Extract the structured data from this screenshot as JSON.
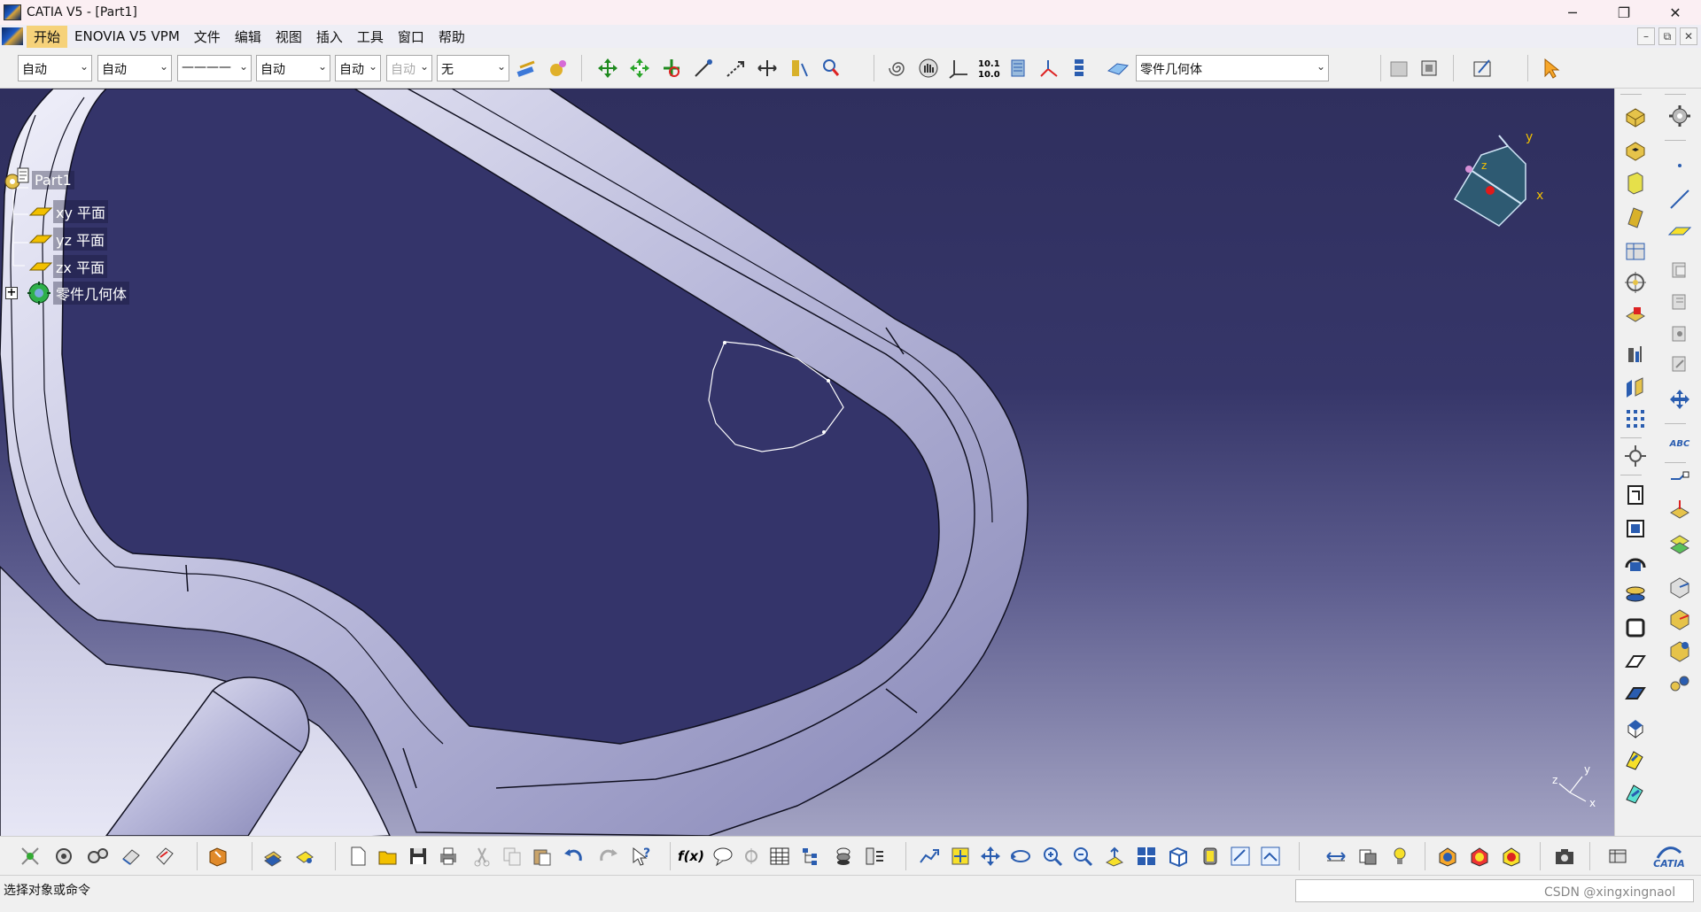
{
  "window": {
    "title": "CATIA V5 - [Part1]",
    "controls": {
      "minimize": "─",
      "restore": "❐",
      "close": "✕"
    }
  },
  "menubar": {
    "items": [
      "开始",
      "ENOVIA V5 VPM",
      "文件",
      "编辑",
      "视图",
      "插入",
      "工具",
      "窗口",
      "帮助"
    ],
    "active_index": 0,
    "child_controls": {
      "minimize": "–",
      "restore": "⧉",
      "close": "✕"
    }
  },
  "toolbar_top": {
    "combos": [
      {
        "value": "自动"
      },
      {
        "value": "自动"
      },
      {
        "value": "————"
      },
      {
        "value": "自动"
      },
      {
        "value": "自动"
      },
      {
        "value": "自动"
      },
      {
        "value": "无"
      }
    ],
    "body_selector": "零件几何体",
    "icons": [
      "paint-format-icon",
      "apply-material-icon",
      "move-compass-icon",
      "snap-icon",
      "rotate-icon",
      "line-tool-icon",
      "vector-icon",
      "measure-icon",
      "measure-item-icon",
      "scan-icon",
      "spiral-icon",
      "hand-icon",
      "axis-system-icon",
      "snap-grid-icon",
      "sketch-icon",
      "work-object-icon",
      "hide-show-icon",
      "plane-icon",
      "swap-icon",
      "part-body-icon",
      "sketcher-icon",
      "select-arrow-icon"
    ],
    "colors": {
      "combo_bg": "#ffffff",
      "toolbar_bg": "#f0f0f0"
    }
  },
  "tree": {
    "root": "Part1",
    "items": [
      {
        "label": "xy 平面",
        "icon": "plane-icon"
      },
      {
        "label": "yz 平面",
        "icon": "plane-icon"
      },
      {
        "label": "zx 平面",
        "icon": "plane-icon"
      },
      {
        "label": "零件几何体",
        "icon": "part-body-icon"
      }
    ],
    "expander": "+"
  },
  "compass": {
    "x_label": "x",
    "y_label": "y",
    "z_label": "z"
  },
  "axis_mini": {
    "x_label": "x",
    "y_label": "y",
    "z_label": "z"
  },
  "viewport": {
    "colors": {
      "bg_top": "#2f2f5e",
      "bg_bottom": "#a3a3c3",
      "part_light": "#e4e4f4",
      "part_mid": "#b2b2d4",
      "part_dark": "#7c7cae",
      "edge": "#101020",
      "accent_yellow": "#f2c000"
    }
  },
  "right_toolbar": {
    "icons": [
      "pad-icon",
      "pocket-icon",
      "shaft-icon",
      "groove-icon",
      "hole-icon",
      "rib-icon",
      "slot-icon",
      "stiffener-icon",
      "solid-combine-icon",
      "multi-section-icon",
      "edge-fillet-icon",
      "chamfer-icon",
      "draft-icon",
      "shell-icon",
      "thickness-icon",
      "thread-icon",
      "remove-face-icon",
      "replace-face-icon",
      "translation-icon",
      "symmetry-icon",
      "mirror-icon",
      "pattern-icon",
      "scaling-icon",
      "split-icon",
      "thick-surface-icon",
      "close-surface-icon",
      "sew-surface-icon",
      "boolean-icon",
      "settings-icon",
      "point-icon",
      "line-icon",
      "plane-tool-icon",
      "axis-icon",
      "annotation-icon",
      "measure-between-icon",
      "weld-icon",
      "constraint-icon"
    ],
    "labels": {
      "text_tool": "ABC"
    }
  },
  "bottom_toolbar": {
    "icons": [
      "sketch-analysis-icon",
      "gear-icon",
      "gears-icon",
      "flag-icon",
      "knowledge-icon",
      "catalog-icon",
      "edit-icon",
      "new-document-icon",
      "open-folder-icon",
      "save-icon",
      "print-icon",
      "cut-icon",
      "copy-icon",
      "paste-icon",
      "undo-icon",
      "redo-icon",
      "help-icon",
      "formula-icon",
      "comment-icon",
      "knowledge-advisor-icon",
      "table-icon",
      "tree-expand-icon",
      "publication-icon",
      "pan-icon",
      "fit-all-icon",
      "pan-cross-icon",
      "rotate-view-icon",
      "zoom-in-icon",
      "zoom-out-icon",
      "normal-view-icon",
      "multi-view-icon",
      "iso-view-icon",
      "shading-icon",
      "hide-show-toggle-icon",
      "swap-visible-icon",
      "measure-icon",
      "apply-material-icon",
      "magnet-icon",
      "lens-icon",
      "sun-icon",
      "lightbulb-icon",
      "camera-icon",
      "kbe-icon"
    ],
    "formula_label": "f(x)",
    "brand": "CATIA"
  },
  "statusbar": {
    "text": "选择对象或命令",
    "watermark": "CSDN @xingxingnaol"
  }
}
